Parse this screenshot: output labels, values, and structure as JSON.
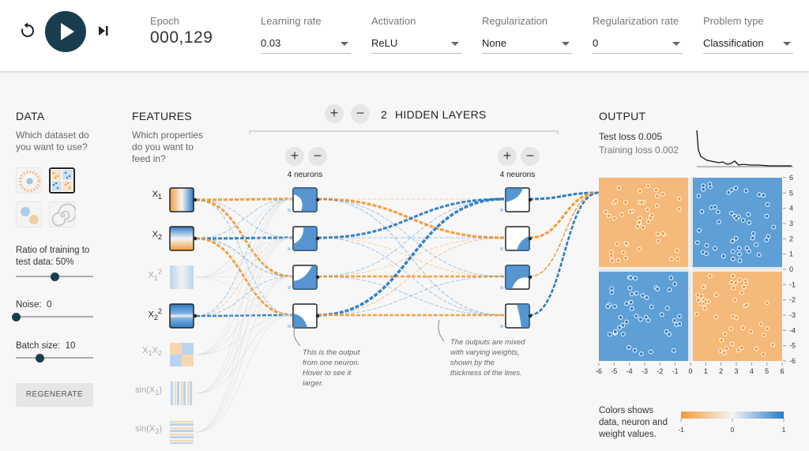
{
  "topbar": {
    "epoch_label": "Epoch",
    "epoch_value": "000,129",
    "controls": [
      {
        "label": "Learning rate",
        "value": "0.03"
      },
      {
        "label": "Activation",
        "value": "ReLU"
      },
      {
        "label": "Regularization",
        "value": "None"
      },
      {
        "label": "Regularization rate",
        "value": "0"
      },
      {
        "label": "Problem type",
        "value": "Classification"
      }
    ]
  },
  "data_panel": {
    "title": "DATA",
    "question": "Which dataset do you want to use?",
    "ratio_label": "Ratio of training to test data:",
    "ratio_value": "50%",
    "ratio_level": 0.5,
    "noise_label": "Noise:",
    "noise_value": "0",
    "noise_level": 0,
    "batch_label": "Batch size:",
    "batch_value": "10",
    "batch_level": 0.31,
    "regenerate_label": "REGENERATE",
    "selected_dataset": "xor"
  },
  "features_panel": {
    "title": "FEATURES",
    "question": "Which properties do you want to feed in?",
    "features": [
      {
        "base": "X",
        "sub": "1",
        "sup": "",
        "active": true
      },
      {
        "base": "X",
        "sub": "2",
        "sup": "",
        "active": true
      },
      {
        "base": "X",
        "sub": "1",
        "sup": "2",
        "active": false
      },
      {
        "base": "X",
        "sub": "2",
        "sup": "2",
        "active": true
      },
      {
        "base": "X",
        "sub": "1",
        "base2": "X",
        "sub2": "2",
        "active": false
      },
      {
        "base": "sin(X",
        "sub": "1",
        "suffix": ")",
        "active": false
      },
      {
        "base": "sin(X",
        "sub": "2",
        "suffix": ")",
        "active": false
      }
    ]
  },
  "network": {
    "add_layer_symbol": "+",
    "remove_layer_symbol": "−",
    "hidden_layers_count": "2",
    "hidden_layers_label": "HIDDEN LAYERS",
    "layers": [
      {
        "neurons_label": "4 neurons"
      },
      {
        "neurons_label": "4 neurons"
      }
    ],
    "note_neuron": "This is the output from one neuron. Hover to see it larger.",
    "note_weights": "The outputs are mixed with varying weights, shown by the thickness of the lines."
  },
  "output": {
    "title": "OUTPUT",
    "test_loss": "Test loss 0.005",
    "training_loss": "Training loss 0.002",
    "x_ticks": [
      "-6",
      "-5",
      "-4",
      "-3",
      "-2",
      "-1",
      "0",
      "1",
      "2",
      "3",
      "4",
      "5",
      "6"
    ],
    "y_ticks": [
      "6",
      "5",
      "4",
      "3",
      "2",
      "1",
      "0",
      "-1",
      "-2",
      "-3",
      "-4",
      "-5",
      "-6"
    ],
    "legend_text": "Colors shows data, neuron and weight values.",
    "legend_ticks": [
      "-1",
      "0",
      "1"
    ],
    "colors": {
      "positive": "#2c7bc4",
      "negative": "#f19c3a",
      "dark": "#183d4e"
    }
  }
}
